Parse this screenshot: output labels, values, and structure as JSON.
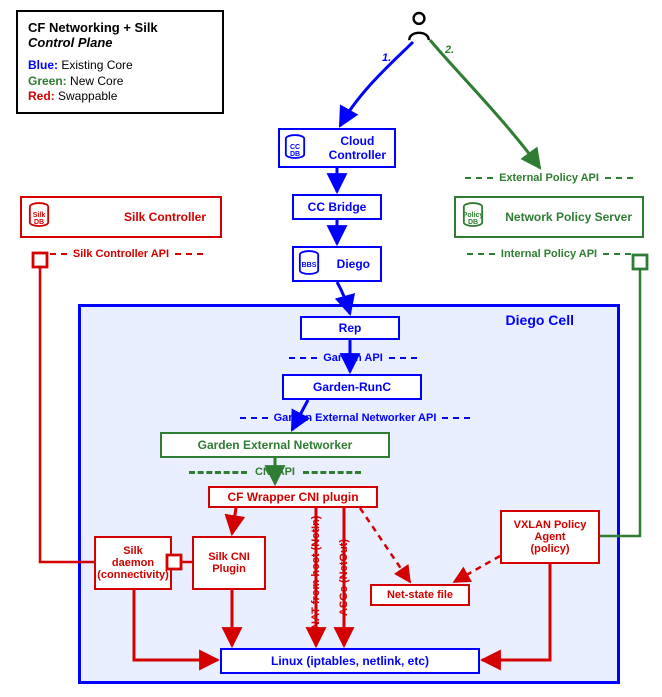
{
  "title": {
    "line1": "CF Networking + Silk",
    "line2": "Control Plane"
  },
  "legend": {
    "blue_label": "Blue:",
    "blue_text": "Existing Core",
    "green_label": "Green:",
    "green_text": "New Core",
    "red_label": "Red:",
    "red_text": "Swappable"
  },
  "nodes": {
    "cloud_controller": "Cloud\nController",
    "cc_bridge": "CC Bridge",
    "diego": "Diego",
    "silk_controller": "Silk Controller",
    "network_policy_server": "Network Policy Server",
    "rep": "Rep",
    "garden_runc": "Garden-RunC",
    "garden_ext_networker": "Garden External Networker",
    "cf_wrapper": "CF Wrapper CNI plugin",
    "silk_daemon": "Silk\ndaemon\n(connectivity)",
    "silk_cni": "Silk CNI\nPlugin",
    "netstate": "Net-state file",
    "vxlan": "VXLAN Policy\nAgent\n(policy)",
    "linux": "Linux (iptables, netlink, etc)"
  },
  "dbs": {
    "cc": "CC\nDB",
    "bbs": "BBS",
    "silk": "Silk\nDB",
    "policy": "Policy\nDB"
  },
  "apis": {
    "external_policy": "External Policy API",
    "internal_policy": "Internal Policy API",
    "silk_controller": "Silk Controller API",
    "garden": "Garden API",
    "garden_ext": "Garden External Networker API",
    "cni": "CNI API"
  },
  "edge_labels": {
    "one": "1.",
    "two": "2."
  },
  "cell_title": "Diego Cell",
  "vertical_labels": {
    "nat": "NAT from host (NetIn)",
    "asg": "ASGs (NetOut)"
  }
}
